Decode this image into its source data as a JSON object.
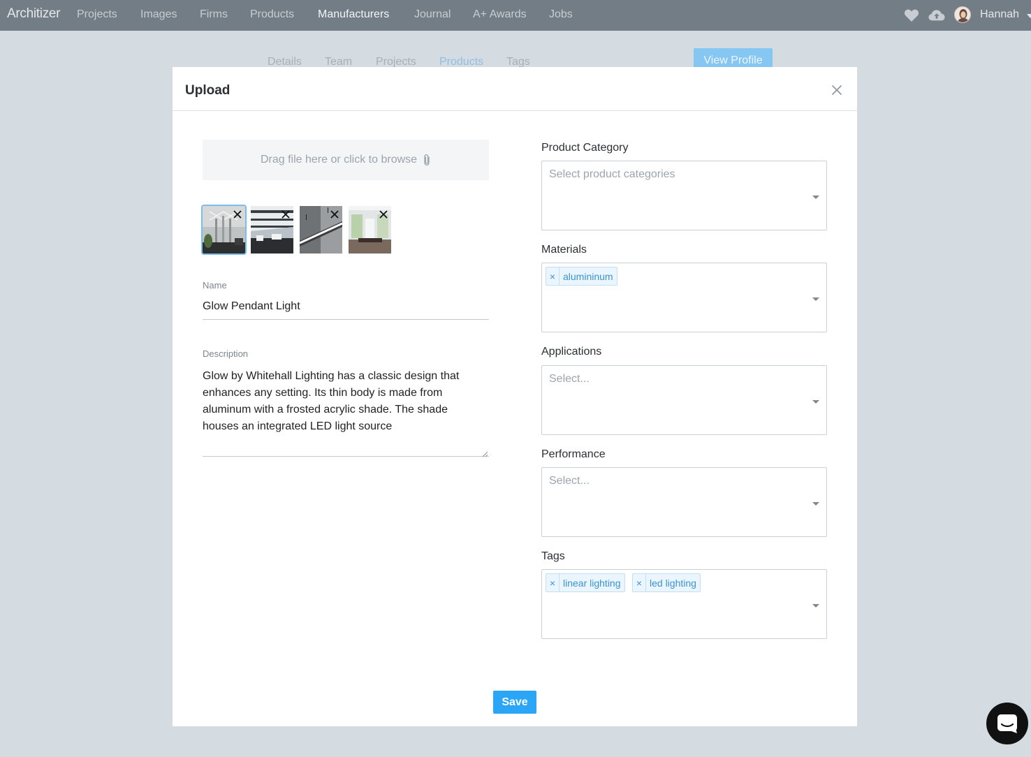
{
  "nav": {
    "brand": "Architizer",
    "items": [
      "Projects",
      "Images",
      "Firms",
      "Products",
      "Manufacturers",
      "Journal",
      "A+ Awards",
      "Jobs"
    ],
    "active_index": 4,
    "user_name": "Hannah"
  },
  "profile_tabs": {
    "items": [
      "Details",
      "Team",
      "Projects",
      "Products",
      "Tags"
    ],
    "active_index": 3,
    "view_profile_label": "View Profile"
  },
  "modal": {
    "title": "Upload",
    "dropzone_text": "Drag file here or click to browse",
    "thumbnails": [
      {
        "name": "thumbnail-1",
        "selected": true
      },
      {
        "name": "thumbnail-2",
        "selected": false
      },
      {
        "name": "thumbnail-3",
        "selected": false
      },
      {
        "name": "thumbnail-4",
        "selected": false
      }
    ],
    "name_label": "Name",
    "name_value": "Glow Pendant Light",
    "description_label": "Description",
    "description_value": "Glow by Whitehall Lighting has a classic design that enhances any setting. Its thin body is made from aluminum with a frosted acrylic shade. The shade houses an integrated LED light source",
    "product_category": {
      "label": "Product Category",
      "placeholder": "Select product categories",
      "chips": []
    },
    "materials": {
      "label": "Materials",
      "placeholder": "",
      "chips": [
        "alumininum"
      ]
    },
    "applications": {
      "label": "Applications",
      "placeholder": "Select...",
      "chips": []
    },
    "performance": {
      "label": "Performance",
      "placeholder": "Select...",
      "chips": []
    },
    "tags": {
      "label": "Tags",
      "placeholder": "",
      "chips": [
        "linear lighting",
        "led lighting"
      ]
    },
    "chip_remove_glyph": "×",
    "save_label": "Save"
  },
  "colors": {
    "nav_bg": "#737d85",
    "page_bg": "#d4dbe1",
    "accent": "#2ba6f6",
    "chip_text": "#3a93d6"
  }
}
